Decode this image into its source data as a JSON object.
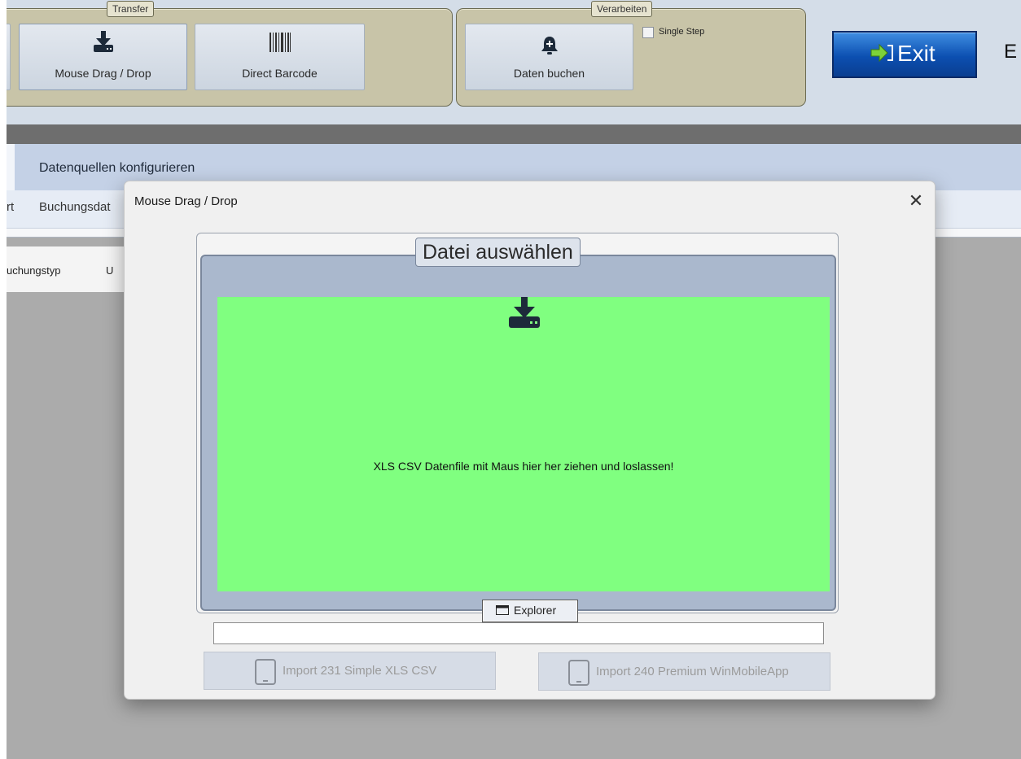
{
  "ribbon": {
    "transfer_group": {
      "title": "Transfer",
      "drag_drop_label": "Mouse Drag / Drop",
      "barcode_label": "Direct Barcode"
    },
    "process_group": {
      "title": "Verarbeiten",
      "book_label": "Daten buchen",
      "single_step_label": "Single Step",
      "single_step_checked": false
    },
    "exit_label": "Exit",
    "partial_label": "E"
  },
  "tabs": {
    "active_label": "Datenquellen konfigurieren"
  },
  "subtabs": {
    "left_fragment": "rt",
    "item": "Buchungsdat"
  },
  "grid": {
    "col1": "uchungstyp",
    "col2": "U"
  },
  "dialog": {
    "title": "Mouse Drag / Drop",
    "close_glyph": "✕",
    "section_title": "Datei auswählen",
    "drop_hint": "XLS CSV Datenfile mit Maus hier her ziehen und loslassen!",
    "explorer_label": "Explorer",
    "path_value": "",
    "import_simple_label": "Import 231 Simple XLS CSV",
    "import_premium_label": "Import 240 Premium WinMobileApp"
  },
  "icons": {
    "drag_drop": "download-drive-icon",
    "barcode": "barcode-icon",
    "book": "bell-plus-icon",
    "exit": "exit-arrow-icon",
    "explorer": "folder-icon",
    "import": "tablet-icon"
  },
  "colors": {
    "dropzone": "#80ff80",
    "exit_button": "#0c4fb1",
    "tab_bar": "#c4d1e6"
  }
}
